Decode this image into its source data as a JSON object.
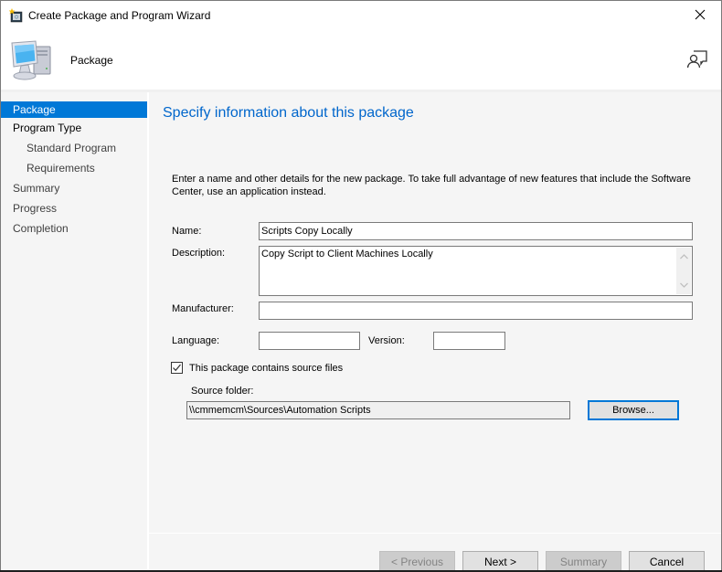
{
  "window": {
    "title": "Create Package and Program Wizard",
    "close_label": "Close"
  },
  "header": {
    "title": "Package"
  },
  "sidebar": {
    "items": [
      {
        "label": "Package",
        "state": "active",
        "level": 0
      },
      {
        "label": "Program Type",
        "state": "normal",
        "level": 0
      },
      {
        "label": "Standard Program",
        "state": "pending",
        "level": 1
      },
      {
        "label": "Requirements",
        "state": "pending",
        "level": 1
      },
      {
        "label": "Summary",
        "state": "pending",
        "level": 0
      },
      {
        "label": "Progress",
        "state": "pending",
        "level": 0
      },
      {
        "label": "Completion",
        "state": "pending",
        "level": 0
      }
    ]
  },
  "main": {
    "heading": "Specify information about this package",
    "intro": "Enter a name and other details for the new package. To take full advantage of new features that include the Software Center, use an application instead.",
    "form": {
      "name_label": "Name:",
      "name_value": "Scripts Copy Locally",
      "description_label": "Description:",
      "description_value": "Copy Script to Client Machines Locally",
      "manufacturer_label": "Manufacturer:",
      "manufacturer_value": "",
      "language_label": "Language:",
      "language_value": "",
      "version_label": "Version:",
      "version_value": "",
      "source_files_checkbox_label": "This package contains source files",
      "source_files_checked": true,
      "source_folder_label": "Source folder:",
      "source_folder_value": "\\\\cmmemcm\\Sources\\Automation Scripts",
      "browse_label": "Browse..."
    }
  },
  "footer": {
    "previous_label": "< Previous",
    "next_label": "Next >",
    "summary_label": "Summary",
    "cancel_label": "Cancel"
  },
  "colors": {
    "accent": "#0078d7",
    "heading": "#0066cc",
    "background": "#f5f5f5"
  }
}
